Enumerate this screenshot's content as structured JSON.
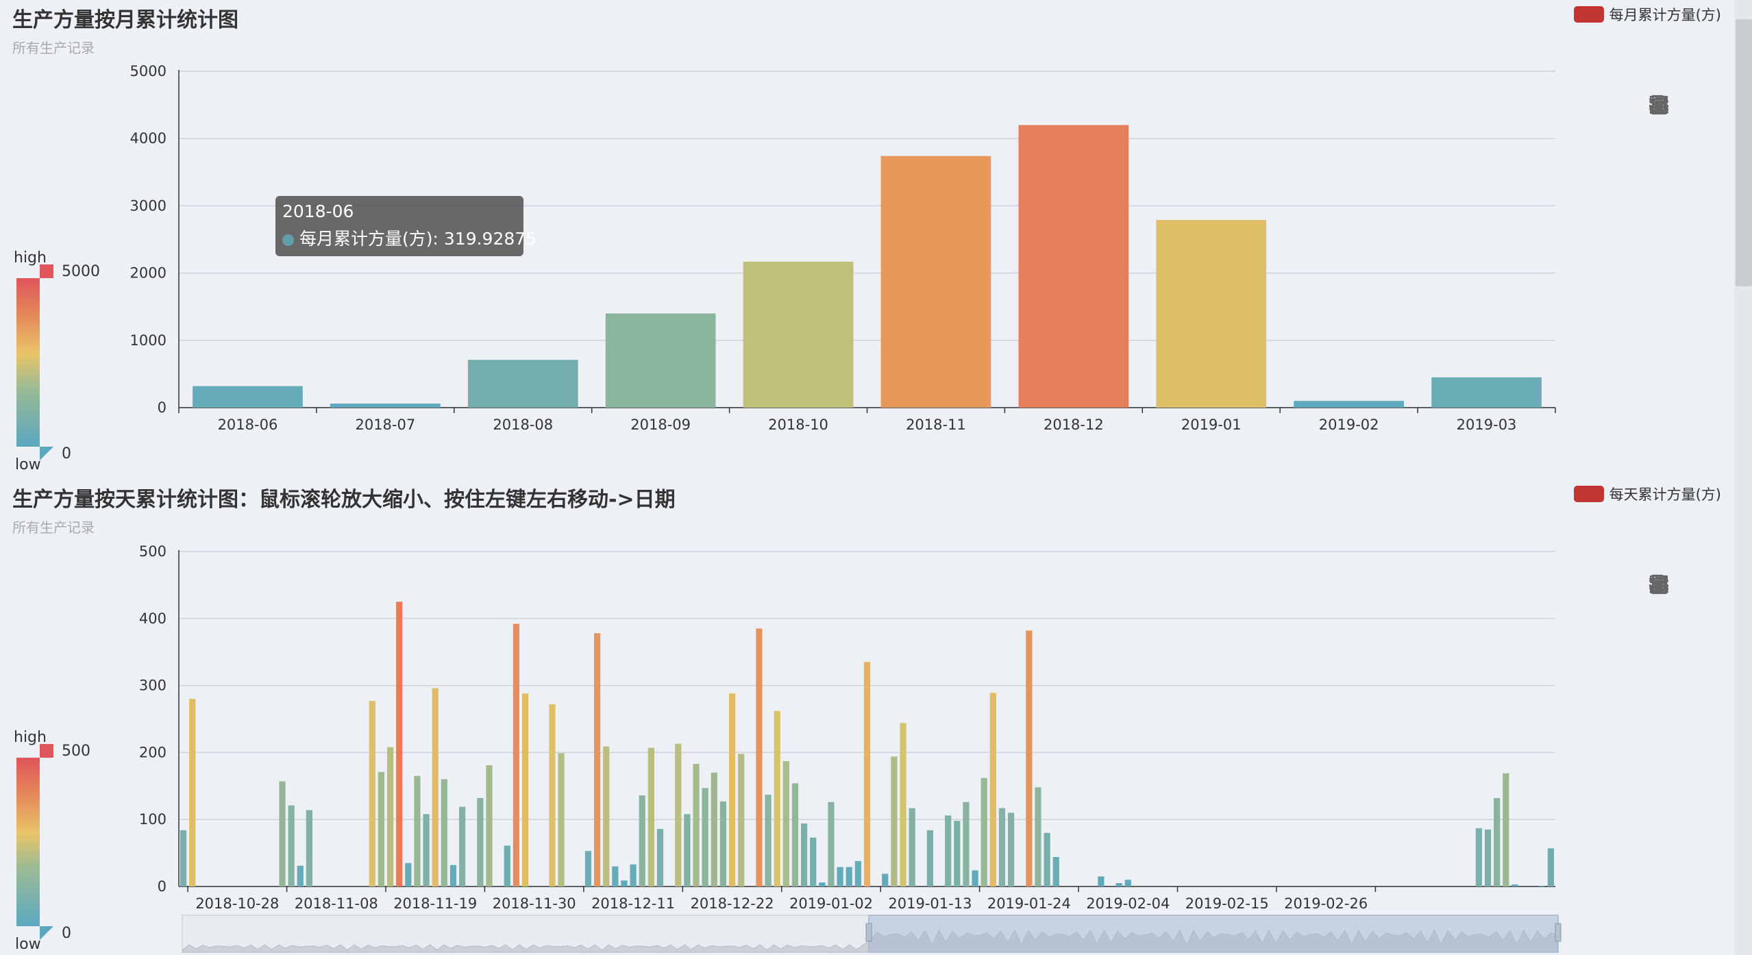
{
  "monthly": {
    "title": "生产方量按月累计统计图",
    "subtitle": "所有生产记录",
    "legend": "每月累计方量(方)",
    "visual_map": {
      "high": "high",
      "low": "low",
      "max": "5000",
      "min": "0"
    },
    "tooltip": {
      "label": "2018-06",
      "series": "每月累计方量(方)",
      "value": "319.92875"
    }
  },
  "daily": {
    "title": "生产方量按天累计统计图：鼠标滚轮放大缩小、按住左键左右移动->日期",
    "subtitle": "所有生产记录",
    "legend": "每天累计方量(方)",
    "visual_map": {
      "high": "high",
      "low": "low",
      "max": "500",
      "min": "0"
    }
  },
  "toolbox": [
    "download-icon",
    "refresh-icon",
    "data-view-icon",
    "line-chart-icon",
    "bar-chart-icon",
    "stack-icon",
    "tiled-icon",
    "zoom-icon",
    "zoom-reset-icon"
  ],
  "colors": {
    "bg": "#edf0f5",
    "low": "#61a0a8",
    "mid": "#eac062",
    "high": "#e0565a",
    "legend_swatch": "#c23531"
  },
  "chart_data": [
    {
      "type": "bar",
      "title": "生产方量按月累计统计图",
      "subtitle": "所有生产记录",
      "categories": [
        "2018-06",
        "2018-07",
        "2018-08",
        "2018-09",
        "2018-10",
        "2018-11",
        "2018-12",
        "2019-01",
        "2019-02",
        "2019-03"
      ],
      "series": [
        {
          "name": "每月累计方量(方)",
          "values": [
            319.92875,
            60,
            710,
            1400,
            2170,
            3740,
            4200,
            2790,
            100,
            450
          ]
        }
      ],
      "ylim": [
        0,
        5000
      ],
      "yticks": [
        0,
        1000,
        2000,
        3000,
        4000,
        5000
      ],
      "grid": true,
      "legend": "top-right"
    },
    {
      "type": "bar",
      "title": "生产方量按天累计统计图：鼠标滚轮放大缩小、按住左键左右移动->日期",
      "subtitle": "所有生产记录",
      "x_start": "2018-10-23",
      "x_tick_labels": [
        "2018-10-28",
        "2018-11-08",
        "2018-11-19",
        "2018-11-30",
        "2018-12-11",
        "2018-12-22",
        "2019-01-02",
        "2019-01-13",
        "2019-01-24",
        "2019-02-04",
        "2019-02-15",
        "2019-02-26"
      ],
      "series": [
        {
          "name": "每天累计方量(方)",
          "values": [
            84,
            280,
            0,
            0,
            0,
            0,
            0,
            0,
            0,
            0,
            0,
            157,
            121,
            31,
            114,
            0,
            0,
            0,
            0,
            0,
            0,
            277,
            171,
            208,
            425,
            35,
            165,
            108,
            296,
            160,
            32,
            119,
            0,
            132,
            181,
            0,
            61,
            392,
            288,
            0,
            0,
            272,
            199,
            0,
            0,
            53,
            378,
            209,
            30,
            9,
            33,
            136,
            207,
            86,
            0,
            213,
            108,
            183,
            147,
            170,
            127,
            288,
            198,
            0,
            385,
            137,
            262,
            187,
            154,
            94,
            73,
            6,
            126,
            29,
            29,
            38,
            335,
            0,
            19,
            194,
            244,
            117,
            0,
            84,
            0,
            106,
            98,
            126,
            24,
            162,
            289,
            117,
            110,
            0,
            382,
            148,
            80,
            44,
            0,
            0,
            0,
            0,
            15,
            0,
            5,
            10,
            0,
            0,
            0,
            0,
            0,
            0,
            0,
            0,
            0,
            0,
            0,
            0,
            0,
            0,
            0,
            0,
            0,
            0,
            0,
            0,
            0,
            0,
            0,
            0,
            0,
            0,
            0,
            0,
            0,
            0,
            0,
            0,
            0,
            0,
            0,
            0,
            0,
            0,
            87,
            85,
            132,
            169,
            3,
            0,
            0,
            1,
            57
          ]
        }
      ],
      "ylim": [
        0,
        500
      ],
      "yticks": [
        0,
        100,
        200,
        300,
        400,
        500
      ],
      "grid": true,
      "legend": "top-right",
      "data_zoom": "slider"
    }
  ]
}
